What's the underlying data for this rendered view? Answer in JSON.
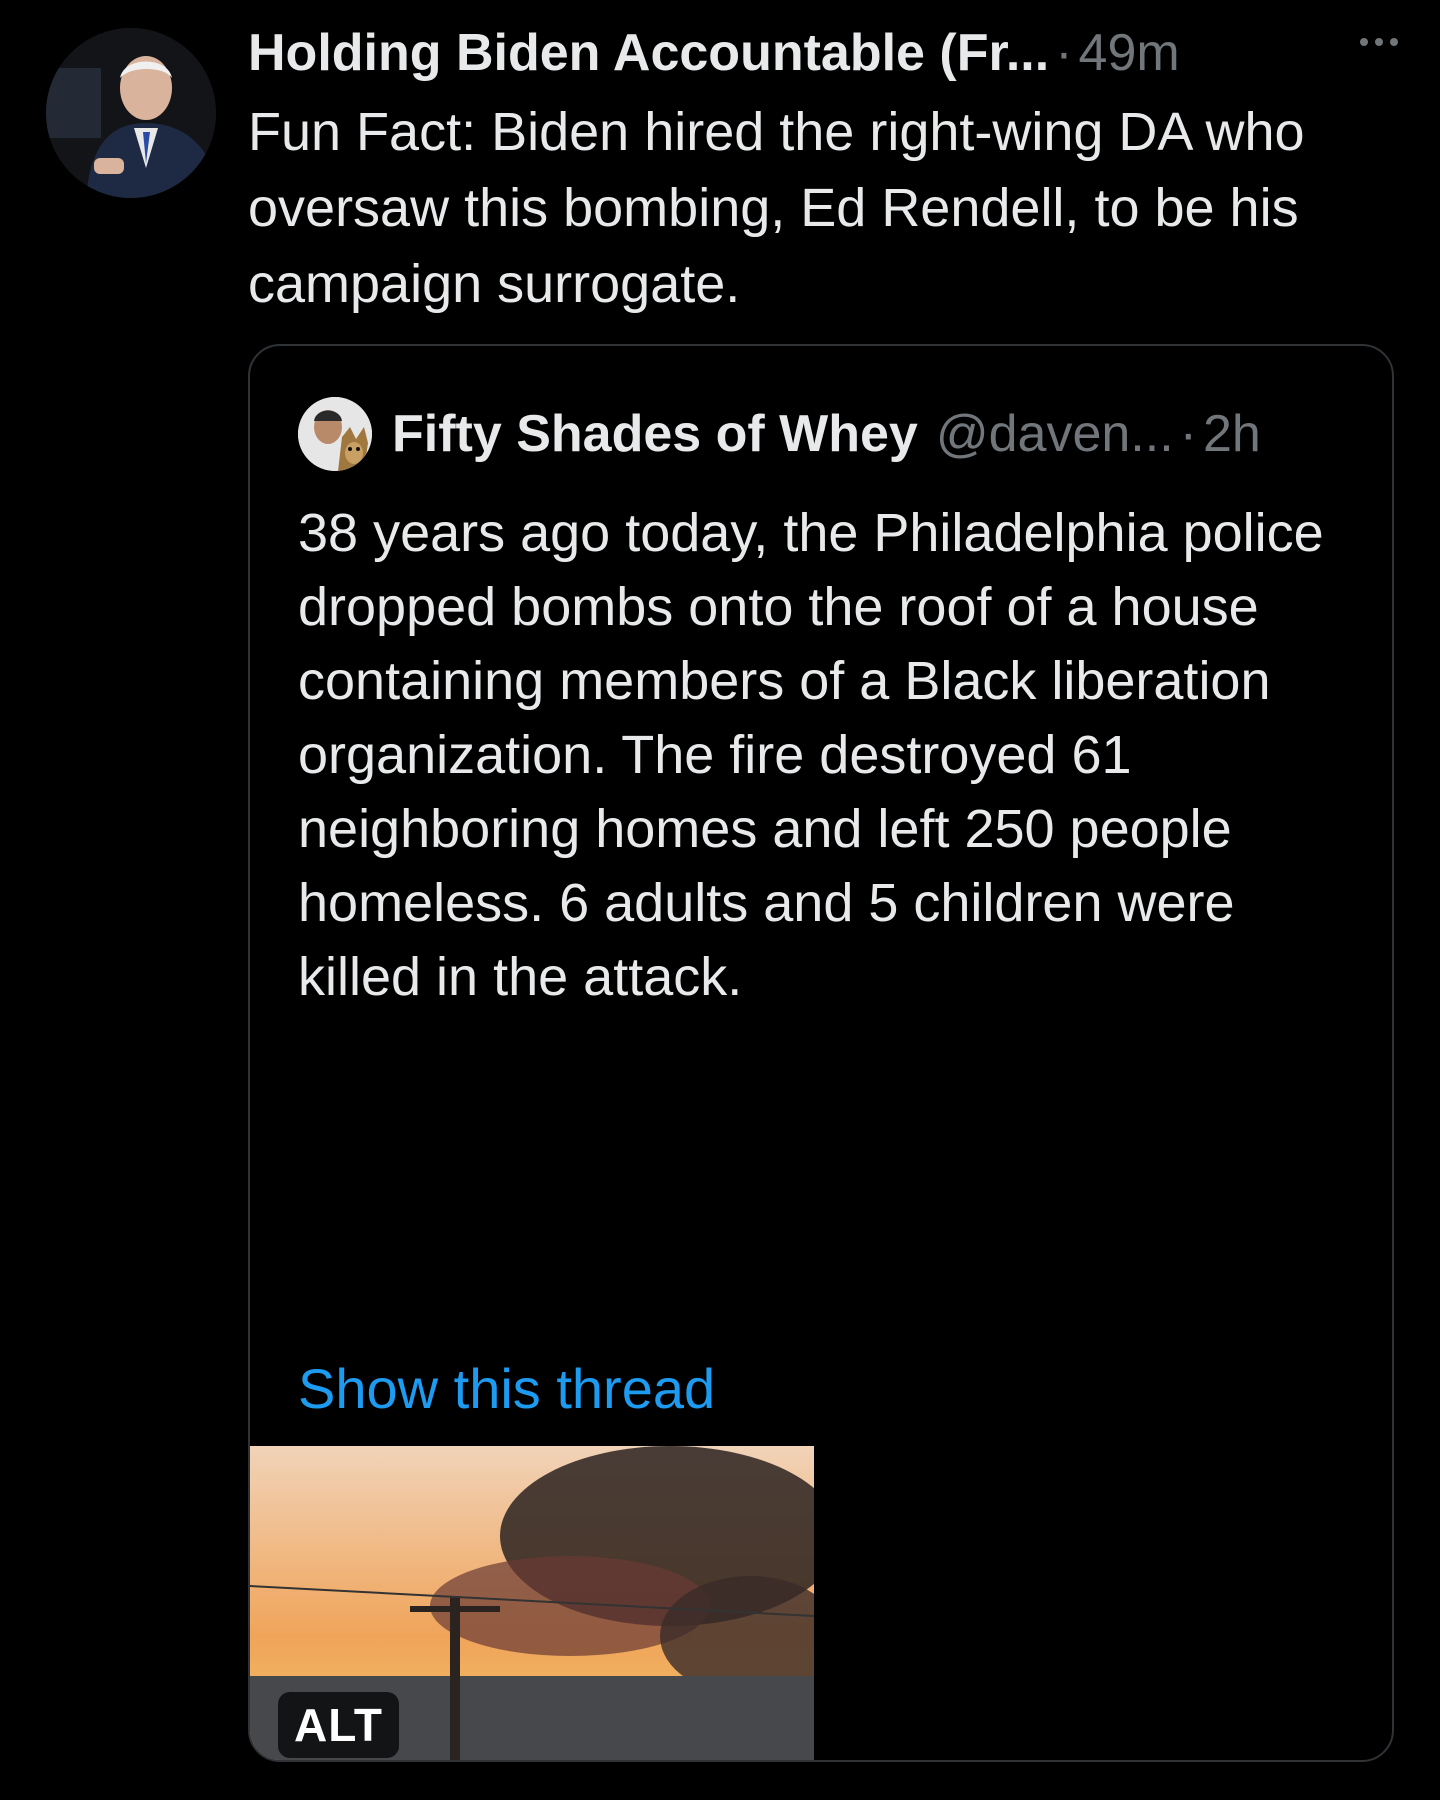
{
  "tweet": {
    "display_name": "Holding Biden Accountable (Fr...",
    "separator": "·",
    "time": "49m",
    "text": "Fun Fact: Biden hired the right-wing DA who oversaw this bombing, Ed Rendell, to be his campaign surrogate.",
    "more_icon": "more-dots-icon"
  },
  "quote": {
    "display_name": "Fifty Shades of Whey",
    "handle": "@daven...",
    "separator": "·",
    "time": "2h",
    "text": "38 years ago today, the Philadelphia police dropped bombs onto the roof of a house containing members of a Black liberation organization. The fire destroyed 61 neighboring homes and left 250 people homeless. 6 adults and 5 children were killed in the attack.",
    "show_thread": "Show this thread"
  },
  "media": {
    "alt_label": "ALT"
  },
  "colors": {
    "background": "#000000",
    "text": "#e7e9ea",
    "muted": "#71767b",
    "link": "#1d9bf0",
    "border": "#2f3336"
  }
}
